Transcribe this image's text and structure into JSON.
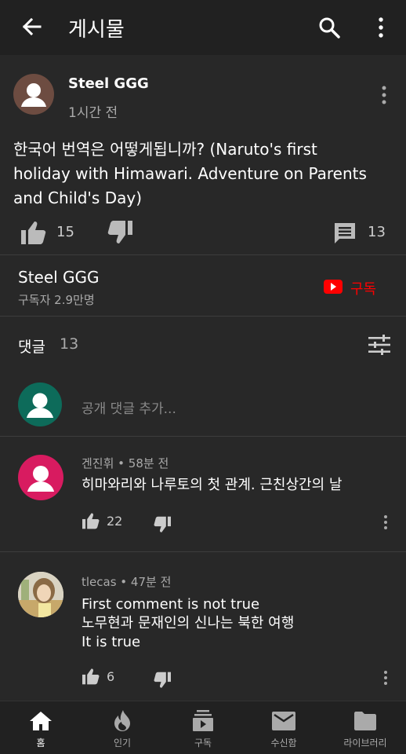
{
  "header": {
    "title": "게시물",
    "icons": [
      "back-arrow-icon",
      "search-icon",
      "more-vert-icon"
    ]
  },
  "post": {
    "author": "Steel GGG",
    "time": "1시간 전",
    "text_lines": [
      "한국어 번역은 어떻게됩니까? (Naruto's first",
      "holiday with Himawari. Adventure on Parents",
      "and Child's Day)"
    ],
    "likes": "15",
    "comments": "13"
  },
  "channel": {
    "name": "Steel GGG",
    "subscribers": "구독자 2.9만명",
    "subscribe_label": "구독"
  },
  "comments_section": {
    "label": "댓글",
    "count": "13",
    "add_placeholder": "공개 댓글 추가..."
  },
  "comments": [
    {
      "author": "겐진휘",
      "time": "58분 전",
      "lines": [
        "히마와리와 나루토의 첫 관계. 근친상간의 날"
      ],
      "likes": "22"
    },
    {
      "author": "tlecas",
      "time": "47분 전",
      "lines": [
        "First comment is not true",
        "노무현과 문재인의 신나는 북한 여행",
        "It is true"
      ],
      "likes": "6"
    }
  ],
  "bottom_nav": {
    "items": [
      {
        "label": "홈",
        "icon": "home-icon"
      },
      {
        "label": "인기",
        "icon": "trending-flame-icon"
      },
      {
        "label": "구독",
        "icon": "subscriptions-icon"
      },
      {
        "label": "수신함",
        "icon": "inbox-mail-icon"
      },
      {
        "label": "라이브러리",
        "icon": "library-folder-icon"
      }
    ]
  },
  "colors": {
    "background": "#282828",
    "topbar": "#212121",
    "subscribe_red": "#ff0000",
    "secondary_text": "#aaaaaa"
  }
}
